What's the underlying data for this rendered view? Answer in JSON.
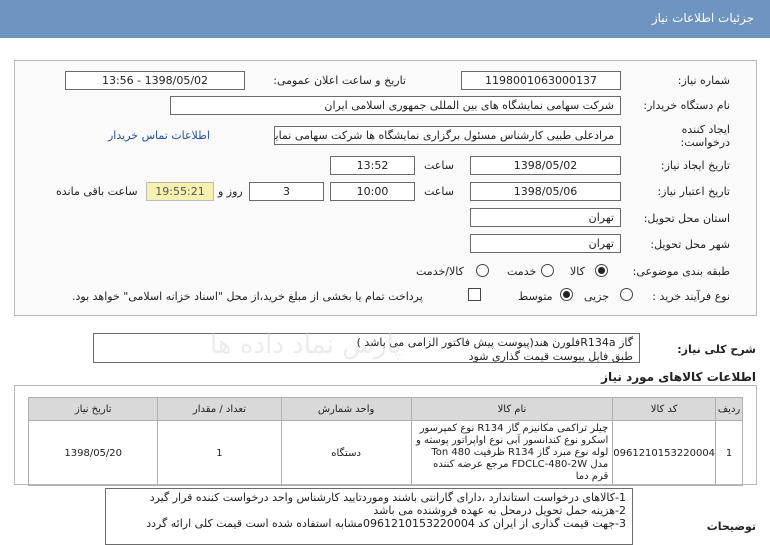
{
  "header": {
    "title": "جزئیات اطلاعات نیاز"
  },
  "form": {
    "need_number_label": "شماره نیاز:",
    "need_number": "1198001063000137",
    "announce_label": "تاریخ و ساعت اعلان عمومی:",
    "announce_value": "1398/05/02 - 13:56",
    "buyer_label": "نام دستگاه خریدار:",
    "buyer_value": "شرکت سهامی نمایشگاه های بین المللی جمهوری اسلامی ایران",
    "creator_label_1": "ایجاد کننده",
    "creator_label_2": "درخواست:",
    "creator_value": "مرادعلی طبیی کارشناس مسئول برگزاری نمایشگاه ها شرکت سهامی نمایشگاه",
    "contact_link": "اطلاعات تماس خریدار",
    "created_date_label": "تاریخ ایجاد نیاز:",
    "created_date": "1398/05/02",
    "time_label": "ساعت",
    "created_time": "13:52",
    "validity_label": "تاریخ اعتبار نیاز:",
    "validity_date": "1398/05/06",
    "validity_time": "10:00",
    "days_value": "3",
    "days_label": "روز و",
    "remaining_time": "19:55:21",
    "remaining_label": "ساعت باقی مانده",
    "province_label": "استان محل تحویل:",
    "province_value": "تهران",
    "city_label": "شهر محل تحویل:",
    "city_value": "تهران",
    "category_label": "طبقه بندی موضوعی:",
    "category_options": [
      "کالا",
      "خدمت",
      "کالا/خدمت"
    ],
    "process_label": "نوع فرآیند خرید :",
    "process_options": [
      "جزیی",
      "متوسط"
    ],
    "payment_note": "پرداخت تمام یا بخشی از مبلغ خرید،از محل \"اسناد خزانه اسلامی\" خواهد بود."
  },
  "summary": {
    "label": "شرح کلی نیاز:",
    "line1": "گاز R134aفلورن هند(پیوست پیش فاکتور الزامی می باشد )",
    "line2": "طبق فایل پیوست قیمت گذاری شود"
  },
  "items_section": {
    "title": "اطلاعات کالاهای مورد نیاز",
    "headers": [
      "ردیف",
      "کد کالا",
      "نام کالا",
      "واحد شمارش",
      "تعداد / مقدار",
      "تاریخ نیاز"
    ],
    "row": {
      "index": "1",
      "code": "0961210153220004",
      "name": "چیلر تراکمی مکانیزم گاز R134 نوع کمپرسور اسکرو نوع کندانسور آبی نوع اواپراتور پوسته و لوله نوع مبرد گاز R134 ظرفیت 480 Ton مدل FDCLC-480-2W مرجع عرضه کننده قرم دما",
      "unit": "دستگاه",
      "qty": "1",
      "date": "1398/05/20"
    }
  },
  "notes": {
    "label": "توضیحات",
    "line1": "1-کالاهای درخواست استاندارد ،دارای گارانتی باشند وموردتایید کارشناس واحد درخواست کننده قرار گیرد",
    "line2": "2-هزینه حمل تحویل درمحل به عهده فروشنده می باشد",
    "line3": "3-جهت قیمت گذاری از ایران کد 0961210153220004مشابه استفاده شده است قیمت کلی ارائه گردد"
  },
  "colors": {
    "header": "#6e94c2",
    "link": "#2350a8",
    "remaining_bg": "#f7f1b0"
  }
}
